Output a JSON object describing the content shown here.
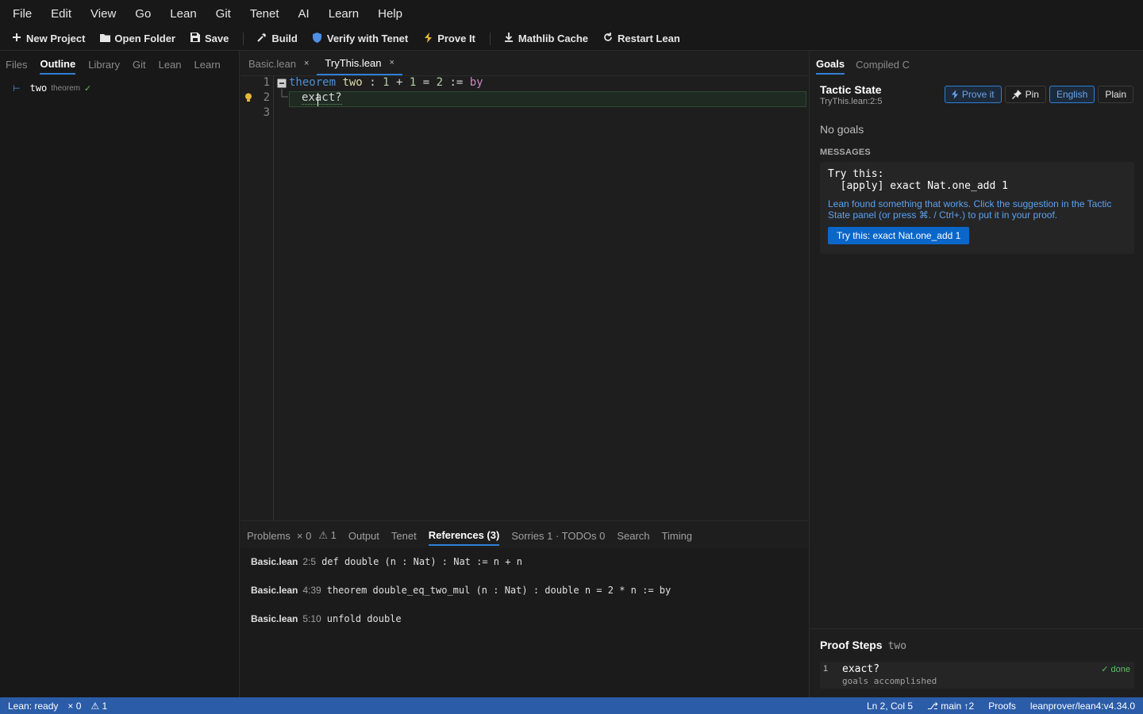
{
  "menu": [
    "File",
    "Edit",
    "View",
    "Go",
    "Lean",
    "Git",
    "Tenet",
    "AI",
    "Learn",
    "Help"
  ],
  "toolbar": {
    "new_project": "New Project",
    "open_folder": "Open Folder",
    "save": "Save",
    "build": "Build",
    "verify": "Verify with Tenet",
    "prove": "Prove It",
    "mathlib": "Mathlib Cache",
    "restart": "Restart Lean"
  },
  "sidebar": {
    "tabs": [
      "Files",
      "Outline",
      "Library",
      "Git",
      "Lean",
      "Learn"
    ],
    "active_tab": "Outline",
    "outline": [
      {
        "name": "two",
        "kind": "theorem",
        "check": "✓"
      }
    ]
  },
  "editor": {
    "tabs": [
      {
        "label": "Basic.lean",
        "close": "×"
      },
      {
        "label": "TryThis.lean",
        "close": "×"
      }
    ],
    "line_numbers": [
      "1",
      "2",
      "3"
    ],
    "code": {
      "l1_kw": "theorem",
      "l1_name": "two",
      "l1_colon": ":",
      "l1_a": "1",
      "l1_plus": "+",
      "l1_b": "1",
      "l1_eq": "=",
      "l1_c": "2",
      "l1_assign": ":=",
      "l1_by": "by",
      "l2": "exact?"
    }
  },
  "panel": {
    "tabs": [
      "Problems",
      "× 0",
      "⚠ 1",
      "Output",
      "Tenet",
      "References (3)",
      "Sorries 1 · TODOs 0",
      "Search",
      "Timing"
    ],
    "references": [
      {
        "file": "Basic.lean",
        "pos": "2:5",
        "snippet": "def double (n : Nat) : Nat := n + n"
      },
      {
        "file": "Basic.lean",
        "pos": "4:39",
        "snippet": "theorem double_eq_two_mul (n : Nat) : double n = 2 * n := by"
      },
      {
        "file": "Basic.lean",
        "pos": "5:10",
        "snippet": "unfold double"
      }
    ]
  },
  "right": {
    "tabs": [
      "Goals",
      "Compiled C"
    ],
    "tactic_title": "Tactic State",
    "tactic_loc": "TryThis.lean:2:5",
    "buttons": {
      "prove": "Prove it",
      "pin": "Pin",
      "english": "English",
      "plain": "Plain"
    },
    "no_goals": "No goals",
    "messages_label": "MESSAGES",
    "try_this": "Try this:\n  [apply] exact Nat.one_add 1",
    "hint": "Lean found something that works. Click the suggestion in the Tactic State panel (or press ⌘. / Ctrl+.) to put it in your proof.",
    "try_button": "Try this: exact Nat.one_add 1",
    "steps_title": "Proof Steps",
    "steps_sub": "two",
    "step": {
      "n": "1",
      "tactic": "exact?",
      "sub": "goals accomplished",
      "status": "✓ done"
    }
  },
  "status": {
    "lean": "Lean: ready",
    "errors": "× 0",
    "warnings": "⚠ 1",
    "pos": "Ln 2, Col 5",
    "branch": "⎇ main ↑2",
    "proofs": "Proofs",
    "toolchain": "leanprover/lean4:v4.34.0"
  },
  "colors": {
    "accent": "#2f7fd6",
    "status_bar": "#2a5ca8",
    "success": "#5fbf5f",
    "try_button": "#0a66c8"
  }
}
